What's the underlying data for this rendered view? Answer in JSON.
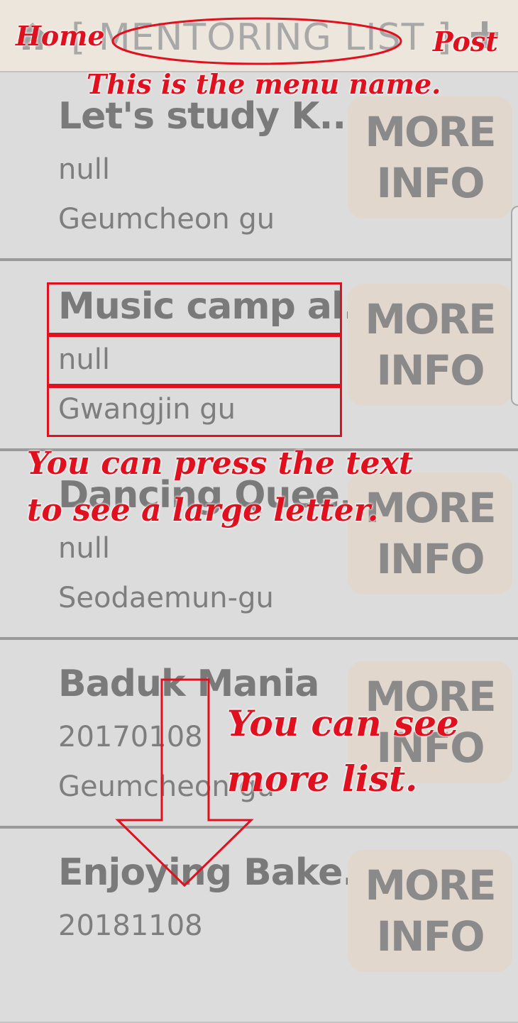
{
  "header": {
    "title": "[ MENTORING LIST ]",
    "home_icon": "home-icon",
    "post_icon": "plus-icon"
  },
  "list": [
    {
      "title": "Let's study K..",
      "date": "null",
      "location": "Geumcheon gu",
      "button": "MORE\nINFO"
    },
    {
      "title": "Music camp al..",
      "date": "null",
      "location": "Gwangjin gu",
      "button": "MORE\nINFO"
    },
    {
      "title": "Dancing Quee..",
      "date": "null",
      "location": "Seodaemun-gu",
      "button": "MORE\nINFO"
    },
    {
      "title": "Baduk Mania",
      "date": "20170108",
      "location": "Geumcheon gu",
      "button": "MORE\nINFO"
    },
    {
      "title": "Enjoying Bake..",
      "date": "20181108",
      "location": "",
      "button": "MORE\nINFO"
    }
  ],
  "annotations": {
    "home": "Home",
    "post": "Post",
    "menu_name": "This is the menu name.",
    "press_text_line1": "You can press the text",
    "press_text_line2": "to see a large letter.",
    "more_list_line1": "You can see",
    "more_list_line2": "more list."
  },
  "colors": {
    "annotation": "#e0101e",
    "header_bg": "#ece6dc",
    "button_bg": "#e2d7cc"
  }
}
